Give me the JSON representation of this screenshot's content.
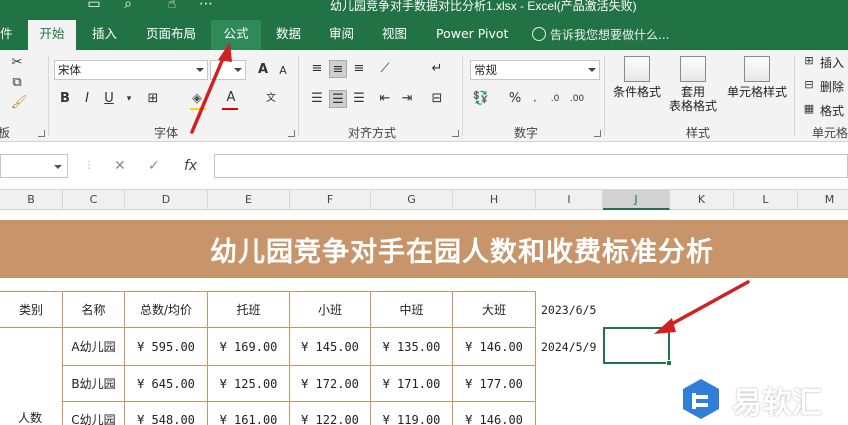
{
  "window": {
    "title": "幼儿园竞争对手数据对比分析1.xlsx - Excel(产品激活失败)"
  },
  "tabs": [
    {
      "label": "件",
      "active": false
    },
    {
      "label": "开始",
      "active": true
    },
    {
      "label": "插入",
      "active": false
    },
    {
      "label": "页面布局",
      "active": false
    },
    {
      "label": "公式",
      "active": false
    },
    {
      "label": "数据",
      "active": false
    },
    {
      "label": "审阅",
      "active": false
    },
    {
      "label": "视图",
      "active": false
    },
    {
      "label": "Power Pivot",
      "active": false
    }
  ],
  "tell_me": {
    "placeholder": "告诉我您想要做什么..."
  },
  "ribbon": {
    "clipboard_label": "板",
    "font": {
      "name": "宋体",
      "label": "字体",
      "grow": "A",
      "shrink": "A"
    },
    "alignment_label": "对齐方式",
    "number": {
      "format": "常规",
      "label": "数字",
      "percent": "%"
    },
    "styles": {
      "label": "样式",
      "conditional": "条件格式",
      "table_line1": "套用",
      "table_line2": "表格格式",
      "cell_styles": "单元格样式"
    },
    "cells": {
      "label": "单元格",
      "insert": "插入",
      "delete": "删除",
      "format": "格式"
    }
  },
  "formula_bar": {
    "cancel": "✕",
    "enter": "✓",
    "fx": "fx"
  },
  "columns": [
    "B",
    "C",
    "D",
    "E",
    "F",
    "G",
    "H",
    "I",
    "J",
    "K",
    "L",
    "M"
  ],
  "selected_column": "J",
  "sheet": {
    "banner_title": "幼儿园竞争对手在园人数和收费标准分析",
    "headers": [
      "类别",
      "名称",
      "总数/均价",
      "托班",
      "小班",
      "中班",
      "大班"
    ],
    "category_label": "人数",
    "rows": [
      {
        "name": "A幼儿园",
        "total": "¥ 595.00",
        "tuo": "¥ 169.00",
        "xiao": "¥ 145.00",
        "zhong": "¥ 135.00",
        "da": "¥ 146.00"
      },
      {
        "name": "B幼儿园",
        "total": "¥ 645.00",
        "tuo": "¥ 125.00",
        "xiao": "¥ 172.00",
        "zhong": "¥ 171.00",
        "da": "¥ 177.00"
      },
      {
        "name": "C幼儿园",
        "total": "¥ 548.00",
        "tuo": "¥ 161.00",
        "xiao": "¥ 122.00",
        "zhong": "¥ 119.00",
        "da": "¥ 146.00"
      }
    ],
    "date1": "2023/6/5",
    "date2": "2024/5/9"
  },
  "watermark": {
    "text": "易软汇"
  },
  "colors": {
    "excel_green": "#217346",
    "banner": "#c8956b",
    "arrow": "#d02020"
  }
}
